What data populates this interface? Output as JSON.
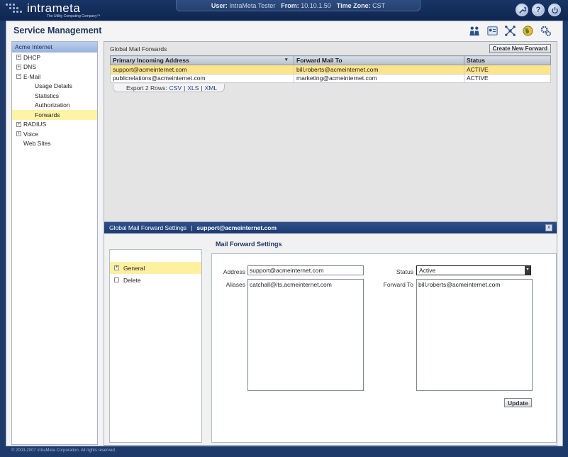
{
  "header": {
    "logo_text": "intrameta",
    "logo_tagline": "The Utility Computing Company™",
    "user_label": "User:",
    "user_value": "IntraMeta Tester",
    "from_label": "From:",
    "from_value": "10.10.1.50",
    "tz_label": "Time Zone:",
    "tz_value": "CST",
    "icons": [
      "wrench-icon",
      "help-icon",
      "power-icon"
    ]
  },
  "page": {
    "title": "Service Management",
    "icons": [
      "users-icon",
      "id-card-icon",
      "network-icon",
      "globe-icon",
      "gears-icon"
    ]
  },
  "sidebar": {
    "header": "Acme Internet",
    "items": [
      {
        "label": "DHCP",
        "level": 0,
        "expander": "+"
      },
      {
        "label": "DNS",
        "level": 0,
        "expander": "+"
      },
      {
        "label": "E-Mail",
        "level": 0,
        "expander": "−"
      },
      {
        "label": "Usage Details",
        "level": 1,
        "expander": ""
      },
      {
        "label": "Statistics",
        "level": 1,
        "expander": ""
      },
      {
        "label": "Authorization",
        "level": 1,
        "expander": ""
      },
      {
        "label": "Forwards",
        "level": 1,
        "expander": "",
        "selected": true
      },
      {
        "label": "RADIUS",
        "level": 0,
        "expander": "+"
      },
      {
        "label": "Voice",
        "level": 0,
        "expander": "+"
      },
      {
        "label": "Web Sites",
        "level": 0,
        "expander": ""
      }
    ]
  },
  "grid": {
    "title": "Global Mail Forwards",
    "create_button": "Create New Forward",
    "columns": [
      "Primary Incoming Address",
      "Forward Mail To",
      "Status"
    ],
    "rows": [
      [
        "support@acmeinternet.com",
        "bill.roberts@acmeinternet.com",
        "ACTIVE"
      ],
      [
        "publicrelations@acmeinternet.com",
        "marketing@acmeinternet.com",
        "ACTIVE"
      ]
    ],
    "export_label": "Export 2 Rows:",
    "export_csv": "CSV",
    "export_xls": "XLS",
    "export_xml": "XML",
    "separator": "|"
  },
  "detail": {
    "title": "Global Mail Forward Settings",
    "separator": "|",
    "subject": "support@acmeinternet.com",
    "close_label": "x",
    "menu": [
      {
        "label": "General",
        "mark": "+"
      },
      {
        "label": "Delete",
        "mark": ""
      }
    ],
    "form_title": "Mail Forward Settings",
    "address_label": "Address",
    "address_value": "support@acmeinternet.com",
    "aliases_label": "Aliases",
    "aliases_value": "catchall@its.acmeinternet.com",
    "status_label": "Status",
    "status_value": "Active",
    "forward_label": "Forward To",
    "forward_value": "bill.roberts@acmeinternet.com",
    "update_button": "Update"
  },
  "footer": {
    "copyright": "© 2003-2007 IntraMeta Corporation.  All rights reserved."
  }
}
